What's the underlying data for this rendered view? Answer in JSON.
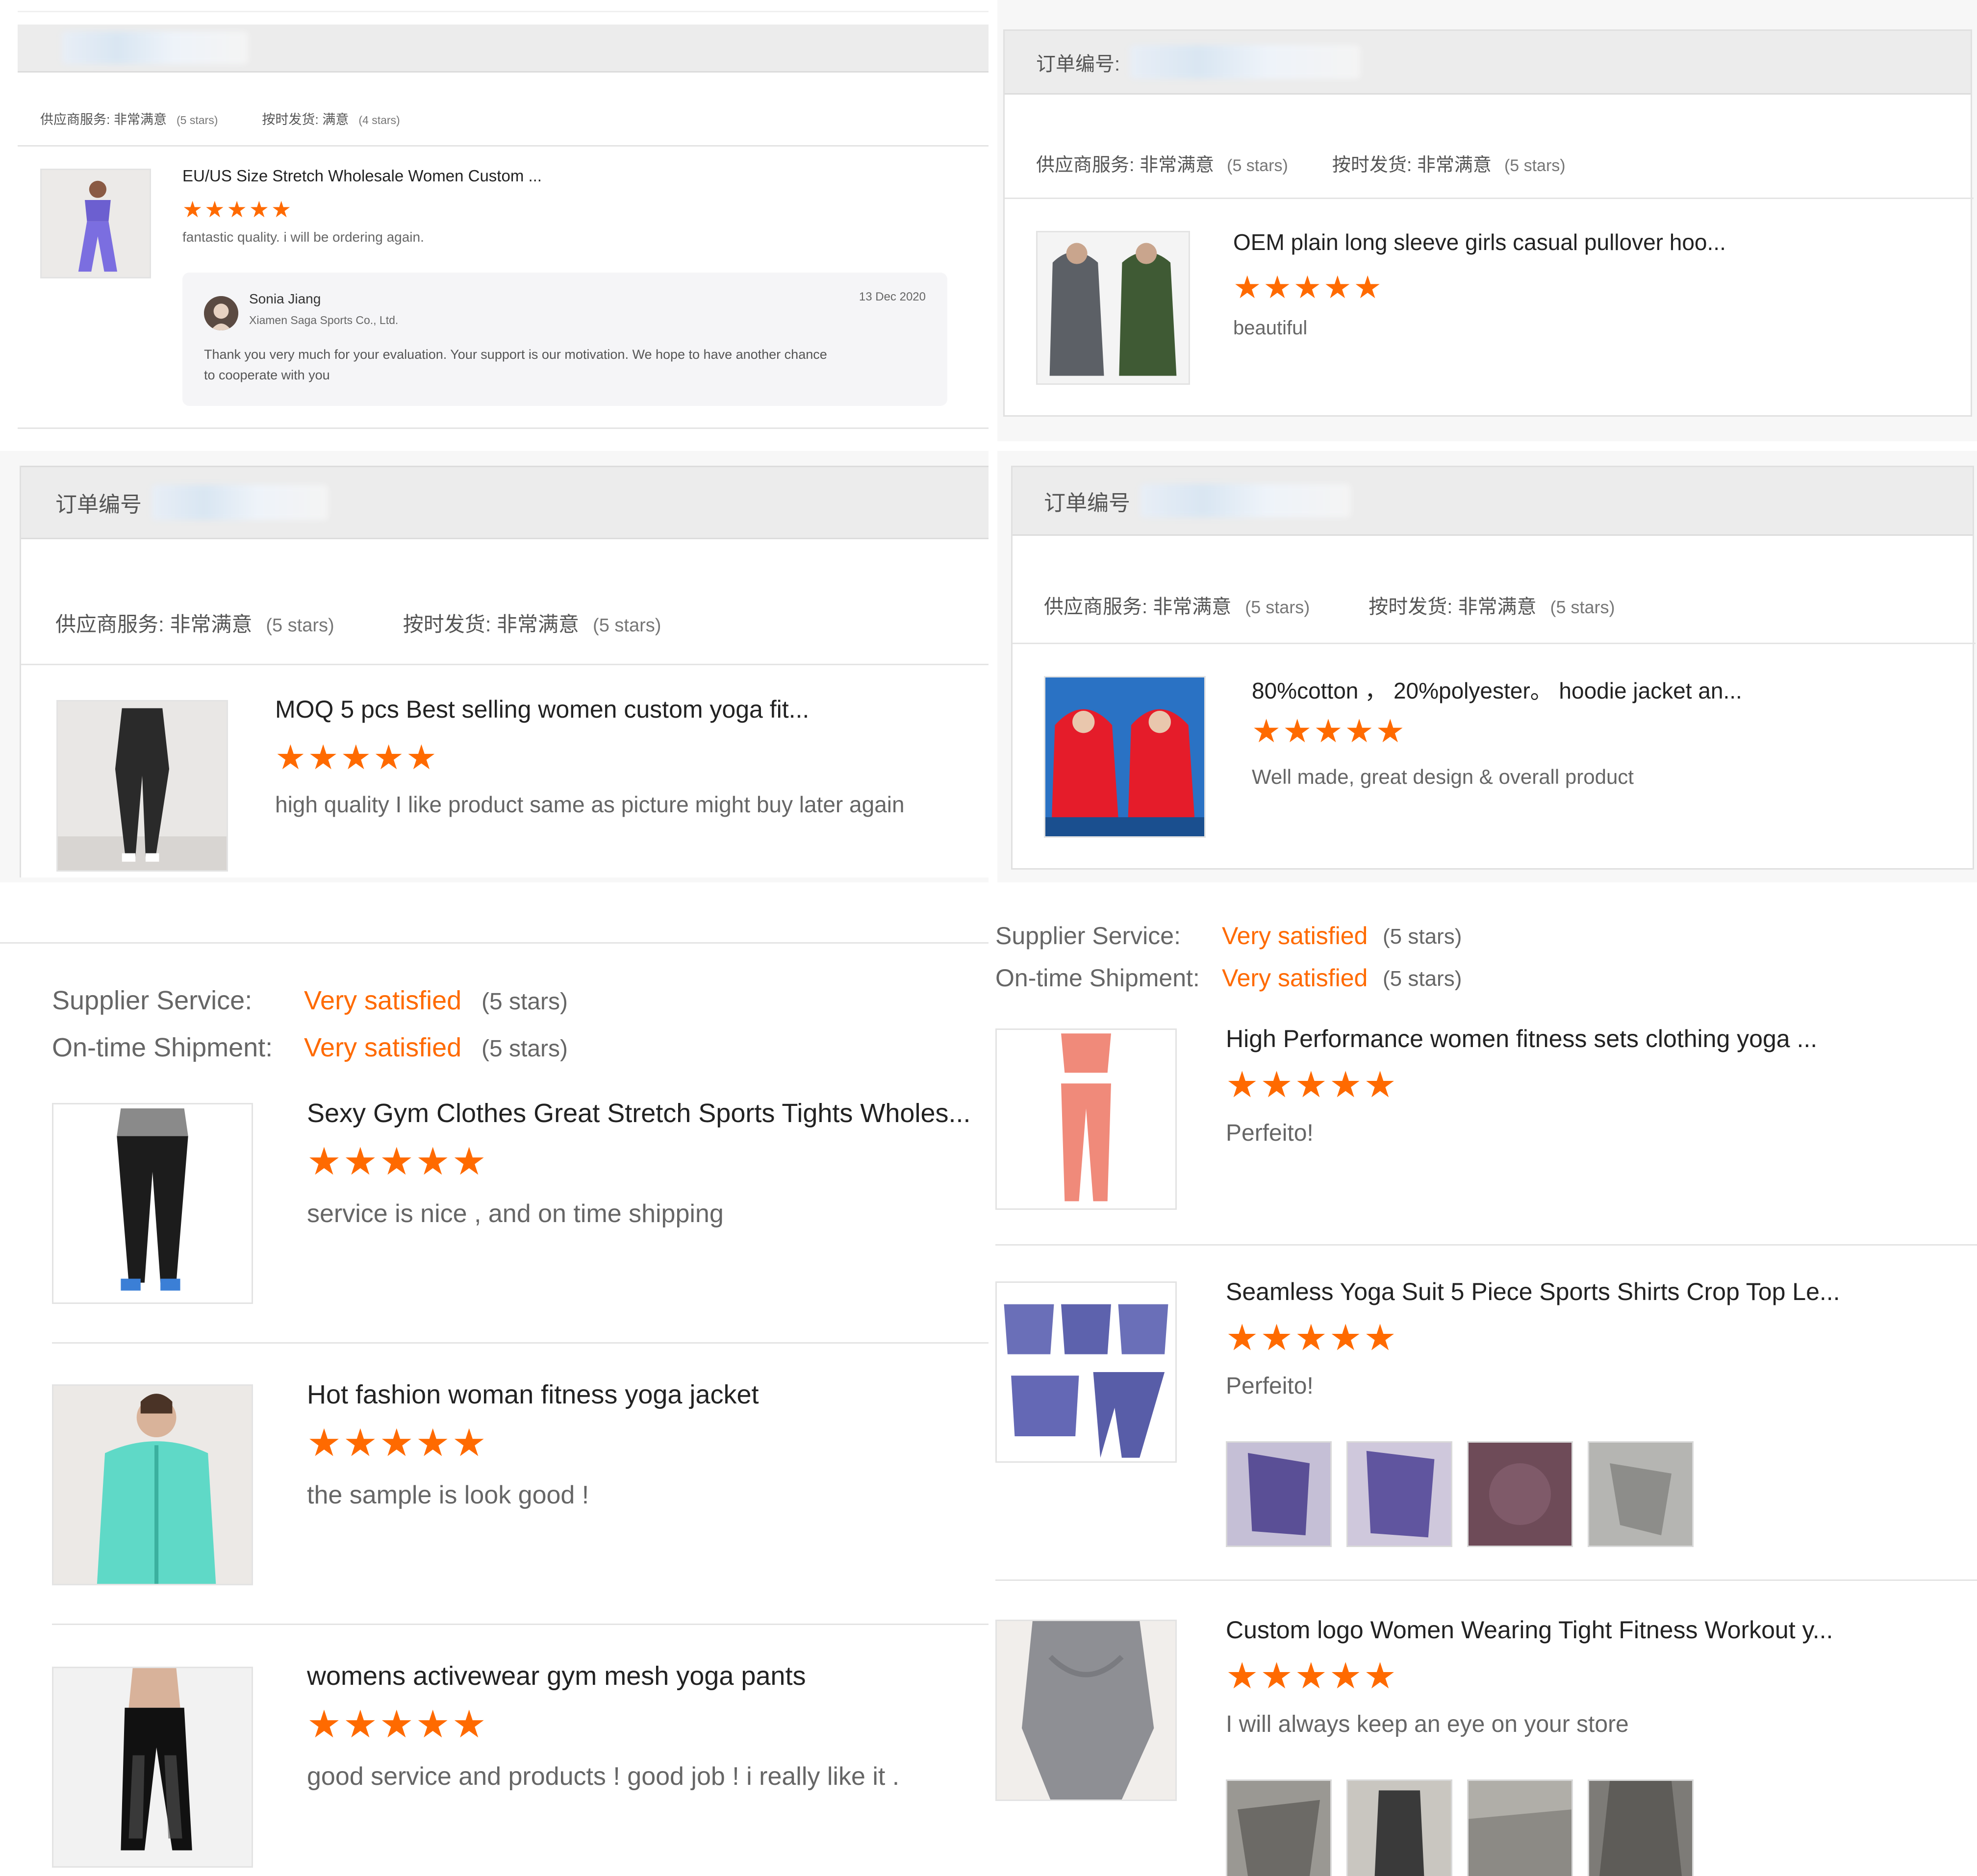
{
  "panel_top_left": {
    "service_line": "供应商服务: 非常满意",
    "service_stars": "(5 stars)",
    "shipping_line": "按时发货: 满意",
    "shipping_stars": "(4 stars)",
    "product_title": "EU/US Size Stretch Wholesale Women Custom ...",
    "stars": "★★★★★",
    "comment": "fantastic quality.  i will be ordering again.",
    "reply": {
      "name": "Sonia Jiang",
      "company": "Xiamen Saga Sports Co., Ltd.",
      "date": "13 Dec 2020",
      "text_line1": "Thank you very much for your evaluation. Your support is our motivation. We hope to have another chance",
      "text_line2": "to cooperate with you"
    }
  },
  "panel_top_right": {
    "order_label": "订单编号:",
    "service_line": "供应商服务: 非常满意",
    "service_stars": "(5 stars)",
    "shipping_line": "按时发货: 非常满意",
    "shipping_stars": "(5 stars)",
    "product_title": "OEM plain long sleeve girls casual pullover hoo...",
    "stars": "★★★★★",
    "comment": "beautiful"
  },
  "panel_mid_left": {
    "order_label": "订单编号",
    "service_line": "供应商服务: 非常满意",
    "service_stars": "(5 stars)",
    "shipping_line": "按时发货: 非常满意",
    "shipping_stars": "(5 stars)",
    "product_title": "MOQ 5 pcs Best selling women custom yoga fit...",
    "stars": "★★★★★",
    "comment": "high quality I like product same as picture might buy later again"
  },
  "panel_mid_right": {
    "order_label": "订单编号",
    "service_line": "供应商服务: 非常满意",
    "service_stars": "(5 stars)",
    "shipping_line": "按时发货: 非常满意",
    "shipping_stars": "(5 stars)",
    "product_title": "80%cotton  ，  20%polyester。  hoodie jacket an...",
    "stars": "★★★★★",
    "comment": "Well made, great design & overall product"
  },
  "panel_bottom_left": {
    "supplier_label": "Supplier Service:",
    "supplier_value": "Very satisfied",
    "supplier_stars": "(5 stars)",
    "shipment_label": "On-time Shipment:",
    "shipment_value": "Very satisfied",
    "shipment_stars": "(5 stars)",
    "reviews": [
      {
        "title": "Sexy Gym Clothes Great Stretch Sports Tights Wholes...",
        "stars": "★★★★★",
        "comment": "service is nice , and on time shipping"
      },
      {
        "title": "Hot fashion woman fitness yoga jacket",
        "stars": "★★★★★",
        "comment": "the sample is look good !"
      },
      {
        "title": "womens activewear gym mesh yoga pants",
        "stars": "★★★★★",
        "comment": "good service and products ! good job ! i really like it ."
      }
    ]
  },
  "panel_bottom_right": {
    "supplier_label": "Supplier Service:",
    "supplier_value": "Very satisfied",
    "supplier_stars": "(5 stars)",
    "shipment_label": "On-time Shipment:",
    "shipment_value": "Very satisfied",
    "shipment_stars": "(5 stars)",
    "reviews": [
      {
        "title": "High Performance women fitness sets clothing yoga ...",
        "stars": "★★★★★",
        "comment": "Perfeito!"
      },
      {
        "title": "Seamless Yoga Suit 5 Piece Sports Shirts Crop Top Le...",
        "stars": "★★★★★",
        "comment": "Perfeito!"
      },
      {
        "title": "Custom logo Women Wearing Tight Fitness Workout y...",
        "stars": "★★★★★",
        "comment": "I will always keep an eye on your store"
      }
    ]
  },
  "colors": {
    "accent": "#ff6a00",
    "header_bg": "#ececec",
    "divider": "#e4e4e4"
  }
}
